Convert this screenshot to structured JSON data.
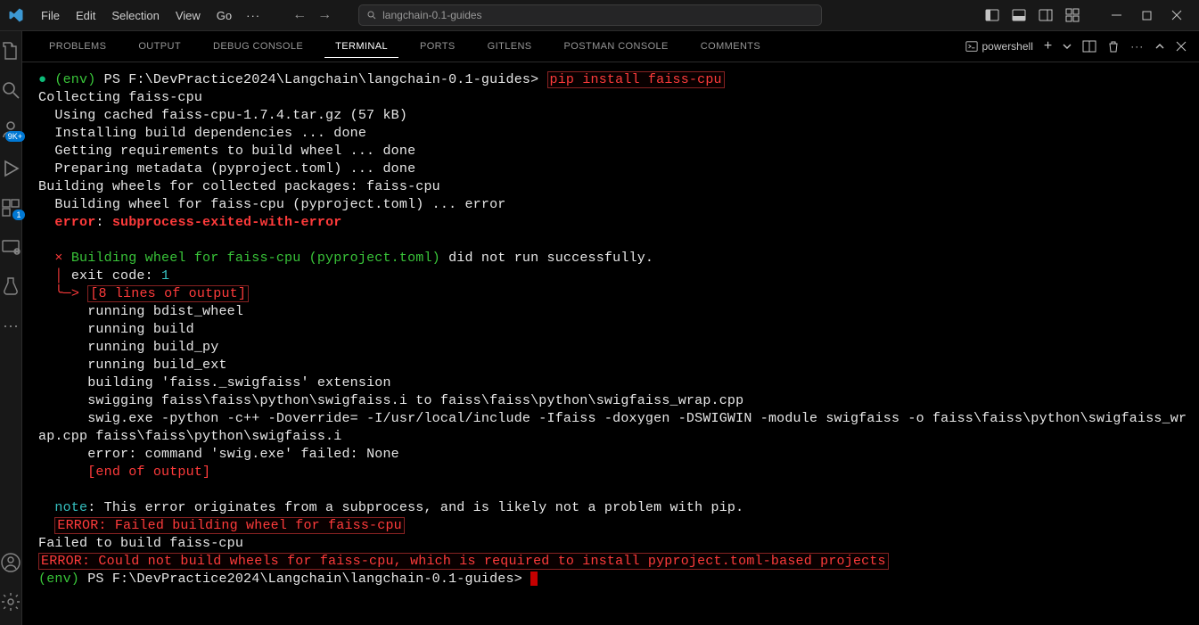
{
  "titlebar": {
    "menus": [
      "File",
      "Edit",
      "Selection",
      "View",
      "Go"
    ],
    "search_placeholder": "langchain-0.1-guides"
  },
  "activity_badges": {
    "profile": "9K+",
    "extensions": "1"
  },
  "panel": {
    "tabs": [
      "PROBLEMS",
      "OUTPUT",
      "DEBUG CONSOLE",
      "TERMINAL",
      "PORTS",
      "GITLENS",
      "POSTMAN CONSOLE",
      "COMMENTS"
    ],
    "active_tab": "TERMINAL",
    "shell_name": "powershell"
  },
  "terminal": {
    "env": "(env)",
    "ps": "PS",
    "cwd": "F:\\DevPractice2024\\Langchain\\langchain-0.1-guides>",
    "command": "pip install faiss-cpu",
    "lines": {
      "collecting": "Collecting faiss-cpu",
      "using_cached": "Using cached faiss-cpu-1.7.4.tar.gz (57 kB)",
      "install_deps": "Installing build dependencies ... done",
      "get_req": "Getting requirements to build wheel ... done",
      "prep_meta": "Preparing metadata (pyproject.toml) ... done",
      "building_wheels": "Building wheels for collected packages: faiss-cpu",
      "building_wheel": "Building wheel for faiss-cpu (pyproject.toml) ... error",
      "error_sub_label": "error",
      "error_sub_msg": "subprocess-exited-with-error",
      "x": "×",
      "build_fail_pre": "Building wheel for faiss-cpu (pyproject.toml)",
      "build_fail_post": " did not run successfully.",
      "pipe": "│",
      "exit_code_label": "exit code: ",
      "exit_code_val": "1",
      "arrow": "╰─>",
      "eight_lines": "[8 lines of output]",
      "out1": "running bdist_wheel",
      "out2": "running build",
      "out3": "running build_py",
      "out4": "running build_ext",
      "out5": "building 'faiss._swigfaiss' extension",
      "out6": "swigging faiss\\faiss\\python\\swigfaiss.i to faiss\\faiss\\python\\swigfaiss_wrap.cpp",
      "out7a": "swig.exe -python -c++ -Doverride= -I/usr/local/include -Ifaiss -doxygen -DSWIGWIN -module swigfaiss -o faiss\\faiss\\python\\swigfaiss_wr",
      "out7b": "ap.cpp faiss\\faiss\\python\\swigfaiss.i",
      "out8": "error: command 'swig.exe' failed: None",
      "end_output": "[end of output]",
      "note_label": "note",
      "note_msg": ": This error originates from a subprocess, and is likely not a problem with pip.",
      "err_failed": "ERROR: Failed building wheel for faiss-cpu",
      "failed_build": "Failed to build faiss-cpu",
      "err_final": "ERROR: Could not build wheels for faiss-cpu, which is required to install pyproject.toml-based projects"
    }
  }
}
